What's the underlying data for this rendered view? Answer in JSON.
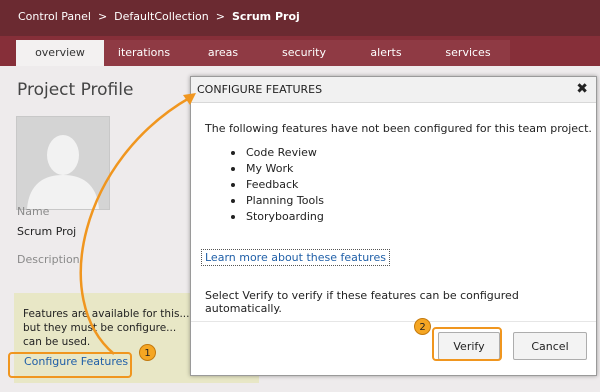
{
  "breadcrumb": {
    "items": [
      "Control Panel",
      "DefaultCollection"
    ],
    "separator": ">",
    "current": "Scrum Proj"
  },
  "tabs": [
    {
      "label": "overview",
      "active": true
    },
    {
      "label": "iterations",
      "active": false
    },
    {
      "label": "areas",
      "active": false
    },
    {
      "label": "security",
      "active": false
    },
    {
      "label": "alerts",
      "active": false
    },
    {
      "label": "services",
      "active": false
    }
  ],
  "profile": {
    "title": "Project Profile",
    "name_label": "Name",
    "name_value": "Scrum Proj",
    "description_label": "Description"
  },
  "features_panel": {
    "lines": [
      "Features are available for this...",
      "but they must be configure...",
      "can be used."
    ],
    "link_label": "Configure Features"
  },
  "dialog": {
    "title": "CONFIGURE FEATURES",
    "close_glyph": "✖",
    "intro": "The following features have not been configured for this team project.",
    "features": [
      "Code Review",
      "My Work",
      "Feedback",
      "Planning Tools",
      "Storyboarding"
    ],
    "learn_more": "Learn more about these features",
    "verify_text": "Select Verify to verify if these features can be configured automatically.",
    "verify_button": "Verify",
    "cancel_button": "Cancel"
  },
  "callouts": {
    "badge_1": "1",
    "badge_2": "2",
    "accent_color": "#f0961f"
  },
  "colors": {
    "topbar": "#6b2a31",
    "tabbar": "#862f39",
    "link": "#2160a8",
    "features_panel_bg": "#e8e7c6"
  }
}
